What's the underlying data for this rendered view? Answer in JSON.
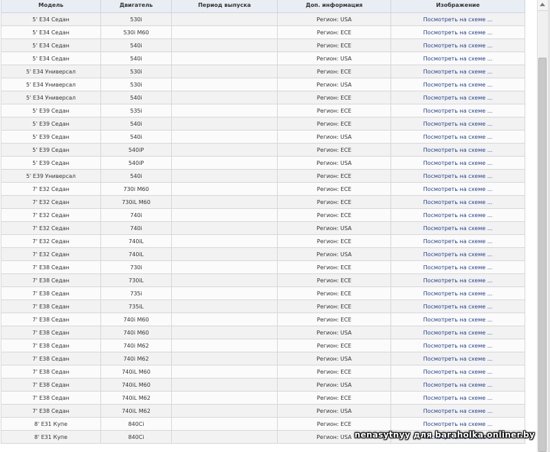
{
  "table": {
    "headers": {
      "model": "Модель",
      "engine": "Двигатель",
      "period": "Период выпуска",
      "info": "Доп. информация",
      "image": "Изображение"
    },
    "rows": [
      {
        "model": "5' E34 Седан",
        "engine": "530i",
        "period": "",
        "info": "Регион: USA",
        "link": "Посмотреть на схеме ..."
      },
      {
        "model": "5' E34 Седан",
        "engine": "530i M60",
        "period": "",
        "info": "Регион: ECE",
        "link": "Посмотреть на схеме ..."
      },
      {
        "model": "5' E34 Седан",
        "engine": "540i",
        "period": "",
        "info": "Регион: ECE",
        "link": "Посмотреть на схеме ..."
      },
      {
        "model": "5' E34 Седан",
        "engine": "540i",
        "period": "",
        "info": "Регион: USA",
        "link": "Посмотреть на схеме ..."
      },
      {
        "model": "5' E34 Универсал",
        "engine": "530i",
        "period": "",
        "info": "Регион: ECE",
        "link": "Посмотреть на схеме ..."
      },
      {
        "model": "5' E34 Универсал",
        "engine": "530i",
        "period": "",
        "info": "Регион: USA",
        "link": "Посмотреть на схеме ..."
      },
      {
        "model": "5' E34 Универсал",
        "engine": "540i",
        "period": "",
        "info": "Регион: ECE",
        "link": "Посмотреть на схеме ..."
      },
      {
        "model": "5' E39 Седан",
        "engine": "535i",
        "period": "",
        "info": "Регион: ECE",
        "link": "Посмотреть на схеме ..."
      },
      {
        "model": "5' E39 Седан",
        "engine": "540i",
        "period": "",
        "info": "Регион: ECE",
        "link": "Посмотреть на схеме ..."
      },
      {
        "model": "5' E39 Седан",
        "engine": "540i",
        "period": "",
        "info": "Регион: USA",
        "link": "Посмотреть на схеме ..."
      },
      {
        "model": "5' E39 Седан",
        "engine": "540iP",
        "period": "",
        "info": "Регион: ECE",
        "link": "Посмотреть на схеме ..."
      },
      {
        "model": "5' E39 Седан",
        "engine": "540iP",
        "period": "",
        "info": "Регион: USA",
        "link": "Посмотреть на схеме ..."
      },
      {
        "model": "5' E39 Универсал",
        "engine": "540i",
        "period": "",
        "info": "Регион: ECE",
        "link": "Посмотреть на схеме ..."
      },
      {
        "model": "7' E32 Седан",
        "engine": "730i M60",
        "period": "",
        "info": "Регион: ECE",
        "link": "Посмотреть на схеме ..."
      },
      {
        "model": "7' E32 Седан",
        "engine": "730iL M60",
        "period": "",
        "info": "Регион: ECE",
        "link": "Посмотреть на схеме ..."
      },
      {
        "model": "7' E32 Седан",
        "engine": "740i",
        "period": "",
        "info": "Регион: ECE",
        "link": "Посмотреть на схеме ..."
      },
      {
        "model": "7' E32 Седан",
        "engine": "740i",
        "period": "",
        "info": "Регион: USA",
        "link": "Посмотреть на схеме ..."
      },
      {
        "model": "7' E32 Седан",
        "engine": "740iL",
        "period": "",
        "info": "Регион: ECE",
        "link": "Посмотреть на схеме ..."
      },
      {
        "model": "7' E32 Седан",
        "engine": "740iL",
        "period": "",
        "info": "Регион: USA",
        "link": "Посмотреть на схеме ..."
      },
      {
        "model": "7' E38 Седан",
        "engine": "730i",
        "period": "",
        "info": "Регион: ECE",
        "link": "Посмотреть на схеме ..."
      },
      {
        "model": "7' E38 Седан",
        "engine": "730iL",
        "period": "",
        "info": "Регион: ECE",
        "link": "Посмотреть на схеме ..."
      },
      {
        "model": "7' E38 Седан",
        "engine": "735i",
        "period": "",
        "info": "Регион: ECE",
        "link": "Посмотреть на схеме ..."
      },
      {
        "model": "7' E38 Седан",
        "engine": "735iL",
        "period": "",
        "info": "Регион: ECE",
        "link": "Посмотреть на схеме ..."
      },
      {
        "model": "7' E38 Седан",
        "engine": "740i M60",
        "period": "",
        "info": "Регион: ECE",
        "link": "Посмотреть на схеме ..."
      },
      {
        "model": "7' E38 Седан",
        "engine": "740i M60",
        "period": "",
        "info": "Регион: USA",
        "link": "Посмотреть на схеме ..."
      },
      {
        "model": "7' E38 Седан",
        "engine": "740i M62",
        "period": "",
        "info": "Регион: ECE",
        "link": "Посмотреть на схеме ..."
      },
      {
        "model": "7' E38 Седан",
        "engine": "740i M62",
        "period": "",
        "info": "Регион: USA",
        "link": "Посмотреть на схеме ..."
      },
      {
        "model": "7' E38 Седан",
        "engine": "740iL M60",
        "period": "",
        "info": "Регион: ECE",
        "link": "Посмотреть на схеме ..."
      },
      {
        "model": "7' E38 Седан",
        "engine": "740iL M60",
        "period": "",
        "info": "Регион: USA",
        "link": "Посмотреть на схеме ..."
      },
      {
        "model": "7' E38 Седан",
        "engine": "740iL M62",
        "period": "",
        "info": "Регион: ECE",
        "link": "Посмотреть на схеме ..."
      },
      {
        "model": "7' E38 Седан",
        "engine": "740iL M62",
        "period": "",
        "info": "Регион: USA",
        "link": "Посмотреть на схеме ..."
      },
      {
        "model": "8' E31 Купе",
        "engine": "840Ci",
        "period": "",
        "info": "Регион: ECE",
        "link": "Посмотреть на схеме ..."
      },
      {
        "model": "8' E31 Купе",
        "engine": "840Ci",
        "period": "",
        "info": "Регион: USA",
        "link": "Посмотреть на схеме ..."
      }
    ]
  },
  "watermark": "nenasytnyy для baraholka.onliner.by",
  "colors": {
    "link": "#1f3f8f",
    "header_bg": "#e9eef5"
  },
  "icons": {
    "scroll_up": "arrow-up-icon"
  }
}
